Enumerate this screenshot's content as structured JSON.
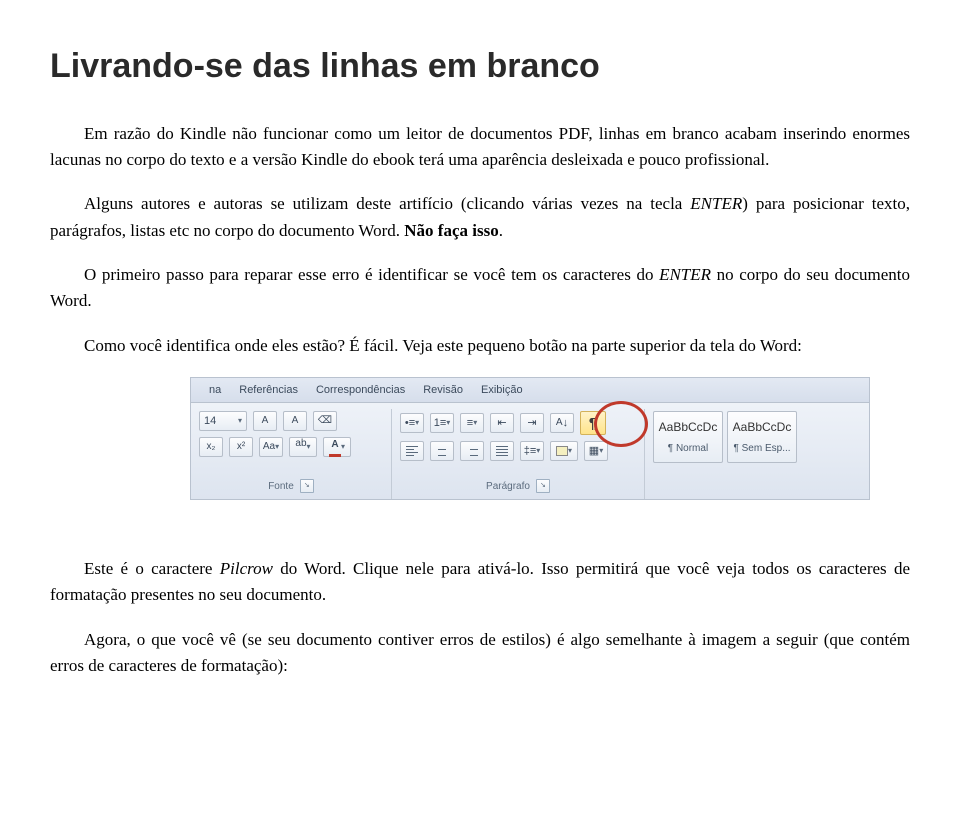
{
  "title": "Livrando-se das linhas em branco",
  "p1": "Em razão do Kindle não funcionar como um leitor de documentos PDF, linhas em branco acabam inserindo enormes lacunas no corpo do texto e a versão Kindle do ebook terá uma aparência desleixada e pouco profissional.",
  "p2a": "Alguns autores e autoras se utilizam deste artifício (clicando várias vezes na tecla ",
  "p2i": "ENTER",
  "p2b": ") para posicionar texto, parágrafos, listas etc no corpo do documento Word. ",
  "p2bold": "Não faça isso",
  "p2c": ".",
  "p3a": "O primeiro passo para reparar esse erro é identificar se você tem os caracteres do ",
  "p3i": "ENTER",
  "p3b": " no corpo do seu documento Word.",
  "p4": "Como você identifica onde eles estão? É fácil. Veja este pequeno botão na parte superior da tela do Word:",
  "ribbon": {
    "tab_partial": "na",
    "tabs": [
      "Referências",
      "Correspondências",
      "Revisão",
      "Exibição"
    ],
    "font_size": "14",
    "group_font": "Fonte",
    "group_para": "Parágrafo",
    "pilcrow": "¶",
    "sort": "A",
    "style_sample": "AaBbCcDc",
    "style1": "¶ Normal",
    "style2": "¶ Sem Esp..."
  },
  "p5a": "Este é o caractere ",
  "p5i": "Pilcrow",
  "p5b": " do Word. Clique nele para ativá-lo. Isso permitirá que você veja todos os caracteres de formatação presentes no seu documento.",
  "p6": "Agora, o que você vê (se seu documento contiver erros de estilos) é algo semelhante à imagem a seguir (que contém erros de caracteres de formatação):"
}
